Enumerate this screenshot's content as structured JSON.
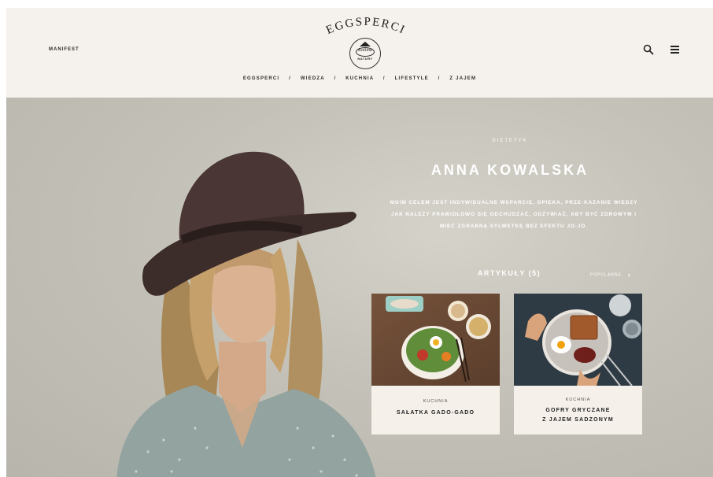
{
  "header": {
    "left_link": "MANIFEST",
    "brand_name": "EGGSPERCI",
    "badge": {
      "title": "Kotlina",
      "subtitle": "NATURY"
    },
    "nav": [
      "EGGSPERCI",
      "WIEDZA",
      "KUCHNIA",
      "LIFESTYLE",
      "Z JAJEM"
    ],
    "nav_separator": "/",
    "icons": {
      "search": "search-icon",
      "menu": "hamburger-menu-icon"
    }
  },
  "hero": {
    "role": "DIETETYK",
    "name": "ANNA KOWALSKA",
    "bio": "MOIM CELEM JEST INDYWIDUALNE WSPARCIE, OPIEKA, PRZE-KAZANIE WIEDZY JAK NALEŻY PRAWIDŁOWO SIĘ ODCHUDZAĆ, ODŻYWIAĆ, ABY BYĆ ZDROWYM I MIEĆ ZGRABNĄ SYLWETKĘ BEZ EFEKTU JO-JO.",
    "articles_label": "ARTYKUŁY (5)",
    "popular_label": "POPULARNE"
  },
  "cards": [
    {
      "category": "KUCHNIA",
      "title": "SAŁATKA GADO-GADO",
      "image": "salad-bowl-photo"
    },
    {
      "category": "KUCHNIA",
      "title_line1": "GOFRY GRYCZANE",
      "title_line2": "Z JAJEM SADZONYM",
      "image": "waffles-egg-photo"
    }
  ],
  "colors": {
    "header_bg": "#f5f1ec",
    "hero_bg": "#c4c2b8",
    "card_bg": "#f5f0ea",
    "text_dark": "#222222",
    "text_light": "#ffffff"
  }
}
